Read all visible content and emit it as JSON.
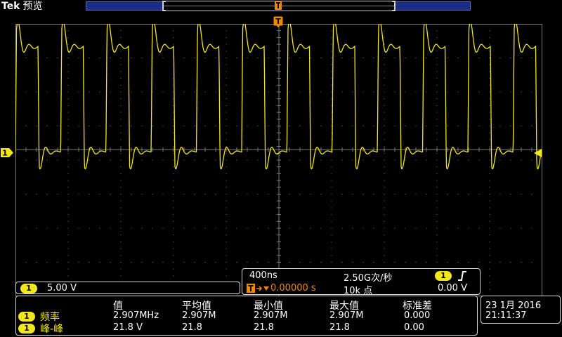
{
  "header": {
    "brand": "Tek",
    "mode": "预览"
  },
  "trigger": {
    "position_marker": "T",
    "level_marker_icon": "trigger-level-arrow-icon"
  },
  "channel1": {
    "number": "1",
    "scale": "5.00 V",
    "color": "#f2e61c"
  },
  "horizontal": {
    "time_per_div": "400ns",
    "sample_rate": "2.50G次/秒",
    "record_length": "10k 点",
    "trigger_channel": "1",
    "trigger_level": "0.00 V",
    "trigger_delay": "0.00000 s",
    "trigger_delay_icon": "trigger-delay-icon",
    "slope_icon": "rising-edge-icon"
  },
  "measurements": {
    "headers": [
      "值",
      "平均值",
      "最小值",
      "最大值",
      "标准差"
    ],
    "rows": [
      {
        "channel": "1",
        "name": "频率",
        "value": "2.907MHz",
        "mean": "2.907M",
        "min": "2.907M",
        "max": "2.907M",
        "std": "0.000"
      },
      {
        "channel": "1",
        "name": "峰-峰",
        "value": "21.8 V",
        "mean": "21.8",
        "min": "21.8",
        "max": "21.8",
        "std": "0.00"
      }
    ]
  },
  "datetime": {
    "date": "23 1月  2016",
    "time": "21:11:37"
  },
  "colors": {
    "trace": "#f2e61c",
    "trigger": "#f28a00",
    "record_strip": "#1b2d86",
    "grid": "#7a7a7a"
  }
}
